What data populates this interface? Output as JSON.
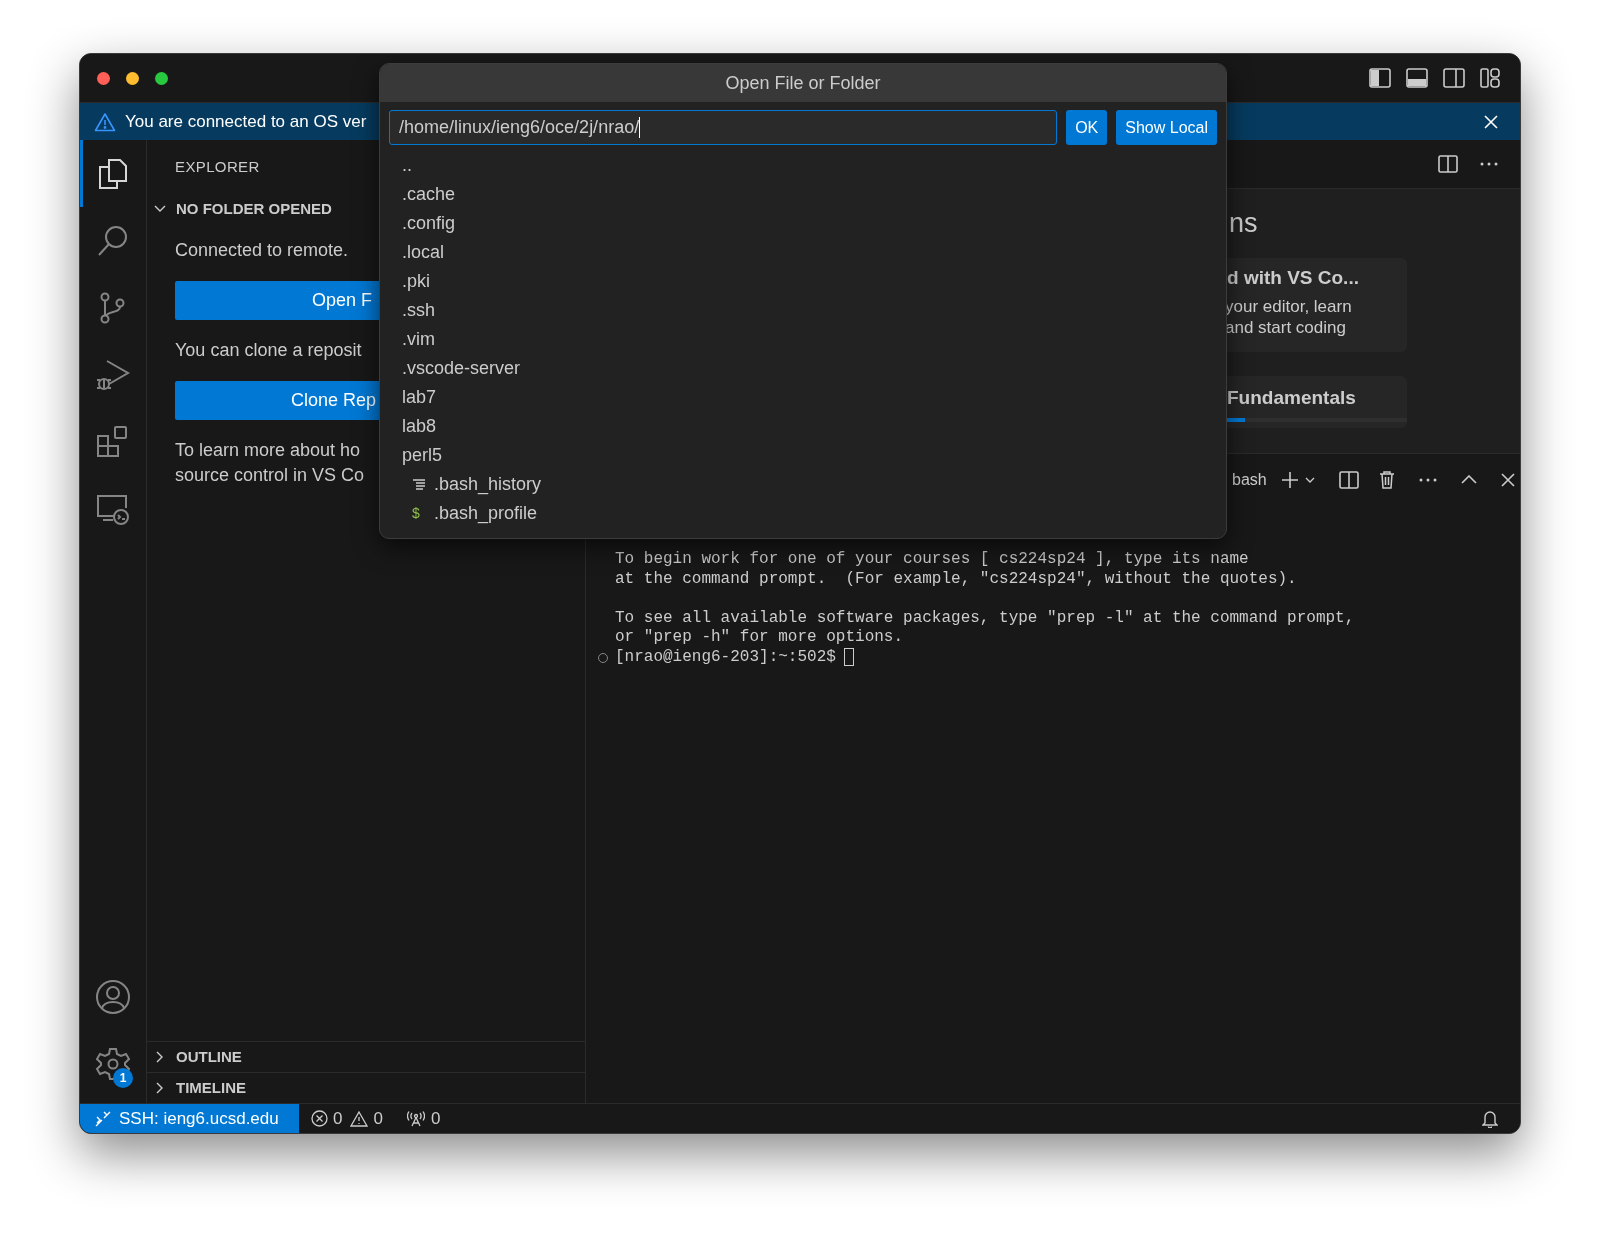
{
  "banner": {
    "text": "You are connected to an OS ver"
  },
  "activity_bar": {
    "items": [
      {
        "kind": "files",
        "selected": true
      },
      {
        "kind": "search",
        "selected": false
      },
      {
        "kind": "branch",
        "selected": false
      },
      {
        "kind": "debug",
        "selected": false
      },
      {
        "kind": "extensions",
        "selected": false
      },
      {
        "kind": "remote",
        "selected": false
      }
    ],
    "bottom": [
      {
        "kind": "account"
      },
      {
        "kind": "settings",
        "badge": "1"
      }
    ]
  },
  "sidebar": {
    "title": "EXPLORER",
    "section": {
      "label": "NO FOLDER OPENED",
      "expanded": true
    },
    "content": [
      {
        "kind": "text",
        "lines": [
          "Connected to remote."
        ]
      },
      {
        "kind": "button",
        "label": "Open F"
      },
      {
        "kind": "text",
        "lines": [
          "You can clone a reposit"
        ]
      },
      {
        "kind": "button",
        "label": "Clone Rep"
      },
      {
        "kind": "text",
        "lines": [
          "To learn more about ho",
          "source control in VS Co"
        ]
      }
    ],
    "collapsed_sections": [
      {
        "label": "OUTLINE",
        "expanded": false
      },
      {
        "label": "TIMELINE",
        "expanded": false
      }
    ]
  },
  "editor": {
    "heading": "ns",
    "cards": [
      {
        "title": "d with VS Co...",
        "lines": [
          "your editor, learn",
          "and start coding"
        ]
      },
      {
        "title": "Fundamentals",
        "level": 0.25
      }
    ]
  },
  "panel": {
    "tab": "bash",
    "terminal": {
      "paragraphs": [
        [
          "To begin work for one of your courses [ cs224sp24 ], type its name",
          "at the command prompt.  (For example, \"cs224sp24\", without the quotes)."
        ],
        [
          "To see all available software packages, type \"prep -l\" at the command prompt,",
          "or \"prep -h\" for more options."
        ]
      ],
      "prompt": "[nrao@ieng6-203]:~:502$"
    }
  },
  "dialog": {
    "title": "Open File or Folder",
    "path": "/home/linux/ieng6/oce/2j/nrao/",
    "buttons": [
      "OK",
      "Show Local"
    ],
    "items": [
      {
        "label": "..",
        "kind": "folder"
      },
      {
        "label": ".cache",
        "kind": "folder"
      },
      {
        "label": ".config",
        "kind": "folder"
      },
      {
        "label": ".local",
        "kind": "folder"
      },
      {
        "label": ".pki",
        "kind": "folder"
      },
      {
        "label": ".ssh",
        "kind": "folder"
      },
      {
        "label": ".vim",
        "kind": "folder"
      },
      {
        "label": ".vscode-server",
        "kind": "folder"
      },
      {
        "label": "lab7",
        "kind": "folder"
      },
      {
        "label": "lab8",
        "kind": "folder"
      },
      {
        "label": "perl5",
        "kind": "folder"
      },
      {
        "label": ".bash_history",
        "kind": "file"
      },
      {
        "label": ".bash_profile",
        "kind": "script",
        "icon": "$"
      }
    ]
  },
  "status_bar": {
    "remote": "SSH: ieng6.ucsd.edu",
    "errors": "0",
    "warnings": "0",
    "ports": "0"
  }
}
